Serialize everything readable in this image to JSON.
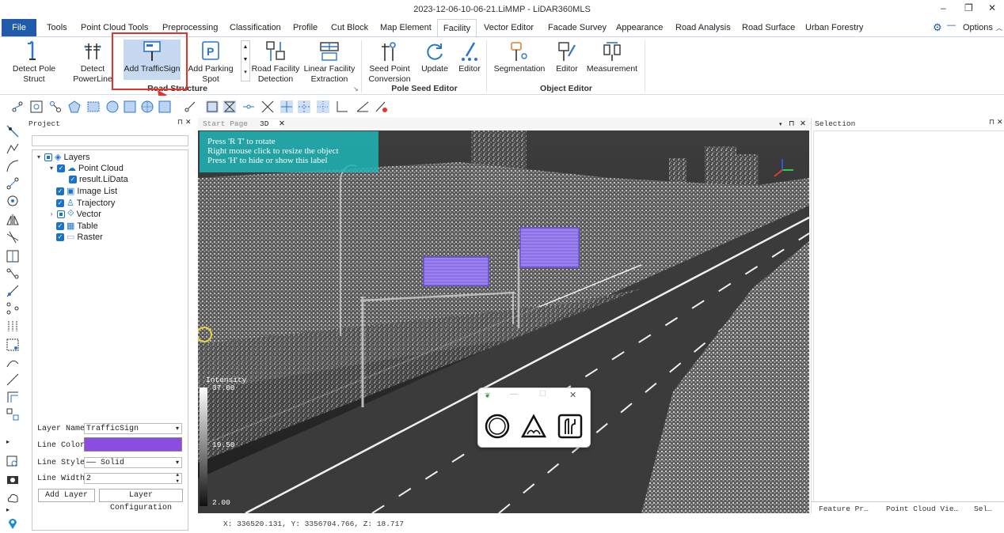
{
  "window": {
    "title": "2023-12-06-10-06-21.LiMMP - LiDAR360MLS",
    "minimize": "–",
    "restore": "❐",
    "close": "✕"
  },
  "menu": {
    "items": [
      "File",
      "Tools",
      "Point Cloud Tools",
      "Preprocessing",
      "Classification",
      "Profile",
      "Cut Block",
      "Map Element",
      "Facility",
      "Vector Editor",
      "Facade Survey",
      "Appearance",
      "Road Analysis",
      "Road Surface",
      "Urban Forestry"
    ],
    "active": "Facility",
    "options": "Options"
  },
  "ribbon": {
    "road_structure": {
      "label": "Road Structure",
      "buttons": [
        "Detect Pole Struct",
        "Detect PowerLine",
        "Add TrafficSign",
        "Add Parking Spot",
        "Road Facility Detection",
        "Linear Facility Extraction"
      ]
    },
    "pole_seed_editor": {
      "label": "Pole Seed Editor",
      "buttons": [
        "Seed Point Conversion",
        "Update",
        "Editor"
      ]
    },
    "object_editor": {
      "label": "Object Editor",
      "buttons": [
        "Segmentation",
        "Editor",
        "Measurement"
      ]
    }
  },
  "project": {
    "title": "Project",
    "tree": [
      {
        "label": "Layers",
        "level": 0
      },
      {
        "label": "Point Cloud",
        "level": 1
      },
      {
        "label": "result.LiData",
        "level": 2
      },
      {
        "label": "Image List",
        "level": 1
      },
      {
        "label": "Trajectory",
        "level": 1
      },
      {
        "label": "Vector",
        "level": 1
      },
      {
        "label": "Table",
        "level": 1
      },
      {
        "label": "Raster",
        "level": 1
      }
    ]
  },
  "properties": {
    "layer_name_label": "Layer Name",
    "layer_name": "TrafficSign",
    "line_color_label": "Line Color",
    "line_color": "#8b4ce0",
    "line_style_label": "Line Style",
    "line_style": "—— Solid",
    "line_width_label": "Line Width",
    "line_width": "2",
    "add_layer": "Add Layer",
    "layer_config": "Layer Configuration"
  },
  "view": {
    "tabs": [
      "Start Page",
      "3D"
    ],
    "hint_lines": [
      "Press 'R T' to rotate",
      "Right mouse click to resize the object",
      "Press 'H' to hide or show this label"
    ],
    "intensity_label": "Intensity",
    "intensity_max": "37.00",
    "intensity_mid": "19.50",
    "intensity_min": "2.00"
  },
  "selection": {
    "title": "Selection",
    "bottom_tabs": [
      "Feature Pr…",
      "Point Cloud Vie…",
      "Sel…"
    ]
  },
  "status": {
    "coords": "X: 336520.131, Y: 3356704.766, Z: 18.717"
  },
  "colors": {
    "accent": "#1f5ba8",
    "sign_fill": "#8b6fe8",
    "annotation": "#e5322d",
    "hint_bg": "#1fb5b5"
  }
}
